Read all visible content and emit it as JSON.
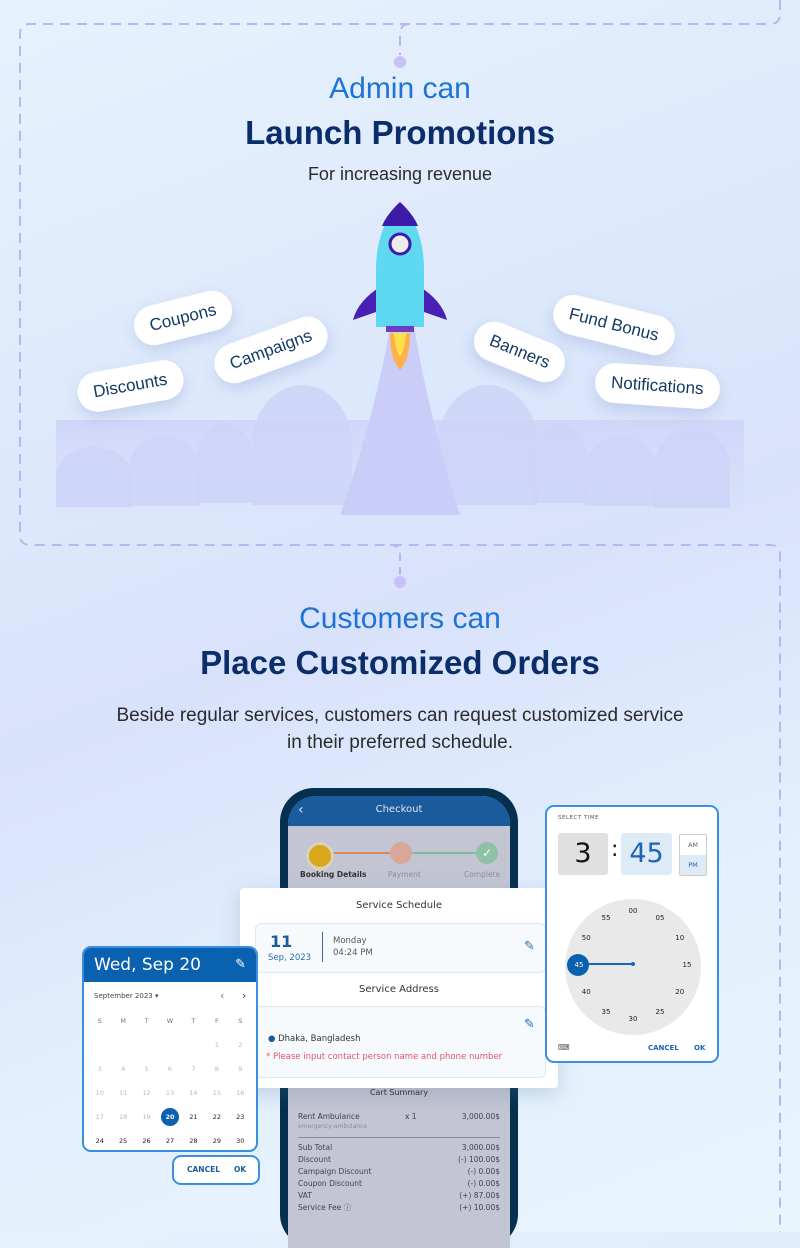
{
  "section1": {
    "subtitle": "Admin can",
    "title": "Launch Promotions",
    "description": "For increasing revenue",
    "tags": [
      "Coupons",
      "Campaigns",
      "Discounts",
      "Banners",
      "Fund Bonus",
      "Notifications"
    ]
  },
  "section2": {
    "subtitle": "Customers can",
    "title": "Place Customized Orders",
    "description": "Beside regular services, customers can request customized service in their preferred schedule."
  },
  "checkout": {
    "header_title": "Checkout",
    "steps": [
      "Booking Details",
      "Payment",
      "Complete"
    ],
    "service_schedule_title": "Service Schedule",
    "schedule_day": "11",
    "schedule_month_year": "Sep, 2023",
    "schedule_weekday": "Monday",
    "schedule_time": "04:24 PM",
    "service_address_title": "Service Address",
    "address": "Dhaka, Bangladesh",
    "address_warning": "* Please input contact person name and phone number",
    "cart_summary_title": "Cart Summary",
    "item_name": "Rent Ambulance",
    "item_sub": "emergency-ambulance",
    "item_qty": "x 1",
    "item_price": "3,000.00$",
    "summary_rows": [
      {
        "label": "Sub Total",
        "value": "3,000.00$"
      },
      {
        "label": "Discount",
        "value": "(-) 100.00$"
      },
      {
        "label": "Campaign Discount",
        "value": "(-) 0.00$"
      },
      {
        "label": "Coupon Discount",
        "value": "(-) 0.00$"
      },
      {
        "label": "VAT",
        "value": "(+) 87.00$"
      },
      {
        "label": "Service Fee ⓘ",
        "value": "(+) 10.00$"
      }
    ]
  },
  "calendar": {
    "header_date": "Wed, Sep 20",
    "month_label": "September 2023 ▾",
    "weekdays": [
      "S",
      "M",
      "T",
      "W",
      "T",
      "F",
      "S"
    ],
    "selected_day": "20",
    "cancel_label": "CANCEL",
    "ok_label": "OK"
  },
  "time_picker": {
    "label": "SELECT TIME",
    "hour": "3",
    "minute": "45",
    "am_label": "AM",
    "pm_label": "PM",
    "selected_period": "PM",
    "minute_marks": [
      "00",
      "05",
      "10",
      "15",
      "20",
      "25",
      "30",
      "35",
      "40",
      "45",
      "50",
      "55"
    ],
    "cancel_label": "CANCEL",
    "ok_label": "OK"
  },
  "colors": {
    "accent": "#1e73d6",
    "title": "#0b2e6b",
    "primary_ui": "#0a61b0",
    "warning": "#e0566b"
  }
}
